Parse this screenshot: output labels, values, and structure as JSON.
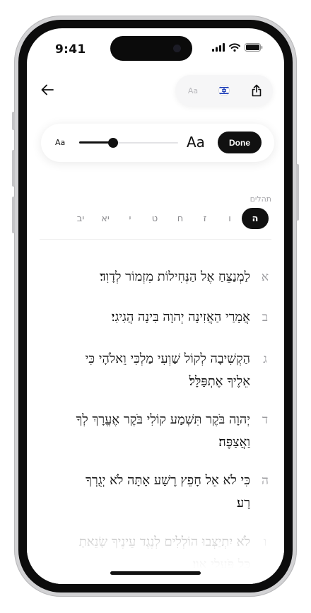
{
  "status_bar": {
    "time": "9:41"
  },
  "toolbar": {
    "font_size_label": "Aa",
    "flag_icon": "israel-flag-icon",
    "share_icon": "share-icon"
  },
  "font_panel": {
    "small_label": "Aa",
    "large_label": "Aa",
    "slider_value": 0.34,
    "done_label": "Done"
  },
  "book": {
    "name": "תהלים"
  },
  "chapters": {
    "items": [
      "ה",
      "ו",
      "ז",
      "ח",
      "ט",
      "י",
      "יא",
      "יב"
    ],
    "selected": "ה"
  },
  "verses": [
    {
      "number": "א",
      "lines": [
        "לַמְנַצֵּחַ אֶל הַנְּחִילוֹת מִזְמוֹר לְדָוִד׃"
      ]
    },
    {
      "number": "ב",
      "lines": [
        "אֲמָרַי הַאֲזִינָה יְהוָה בִּינָה הֲגִיגִי׃"
      ]
    },
    {
      "number": "ג",
      "lines": [
        "הַקְשִׁיבָה לְקוֹל שַׁוְעִי מַלְכִּי וֵאלֹהָי כִּי",
        "אֵלֶיךָ אֶתְפַּלָּל׃"
      ]
    },
    {
      "number": "ד",
      "lines": [
        "יְהוָה בֹּקֶר תִּשְׁמַע קוֹלִי בֹּקֶר אֶעֱרָךְ לְךָ",
        "וַאֲצַפֶּה׃"
      ]
    },
    {
      "number": "ה",
      "lines": [
        "כִּי לֹא אֵל חָפֵץ רֶשַׁע אָתָּה לֹא יְגֻרְךָ",
        "רָע׃"
      ]
    },
    {
      "number": "ו",
      "lines": [
        "לֹא יִתְיַצְּבוּ הוֹלְלִים לְנֶגֶד עֵינֶיךָ שָׂנֵאתָ",
        "כָּל פֹּעֲלֵי אָוֶן׃"
      ]
    }
  ],
  "colors": {
    "accent": "#111111",
    "muted": "#9b9b9f",
    "background": "#ffffff"
  }
}
